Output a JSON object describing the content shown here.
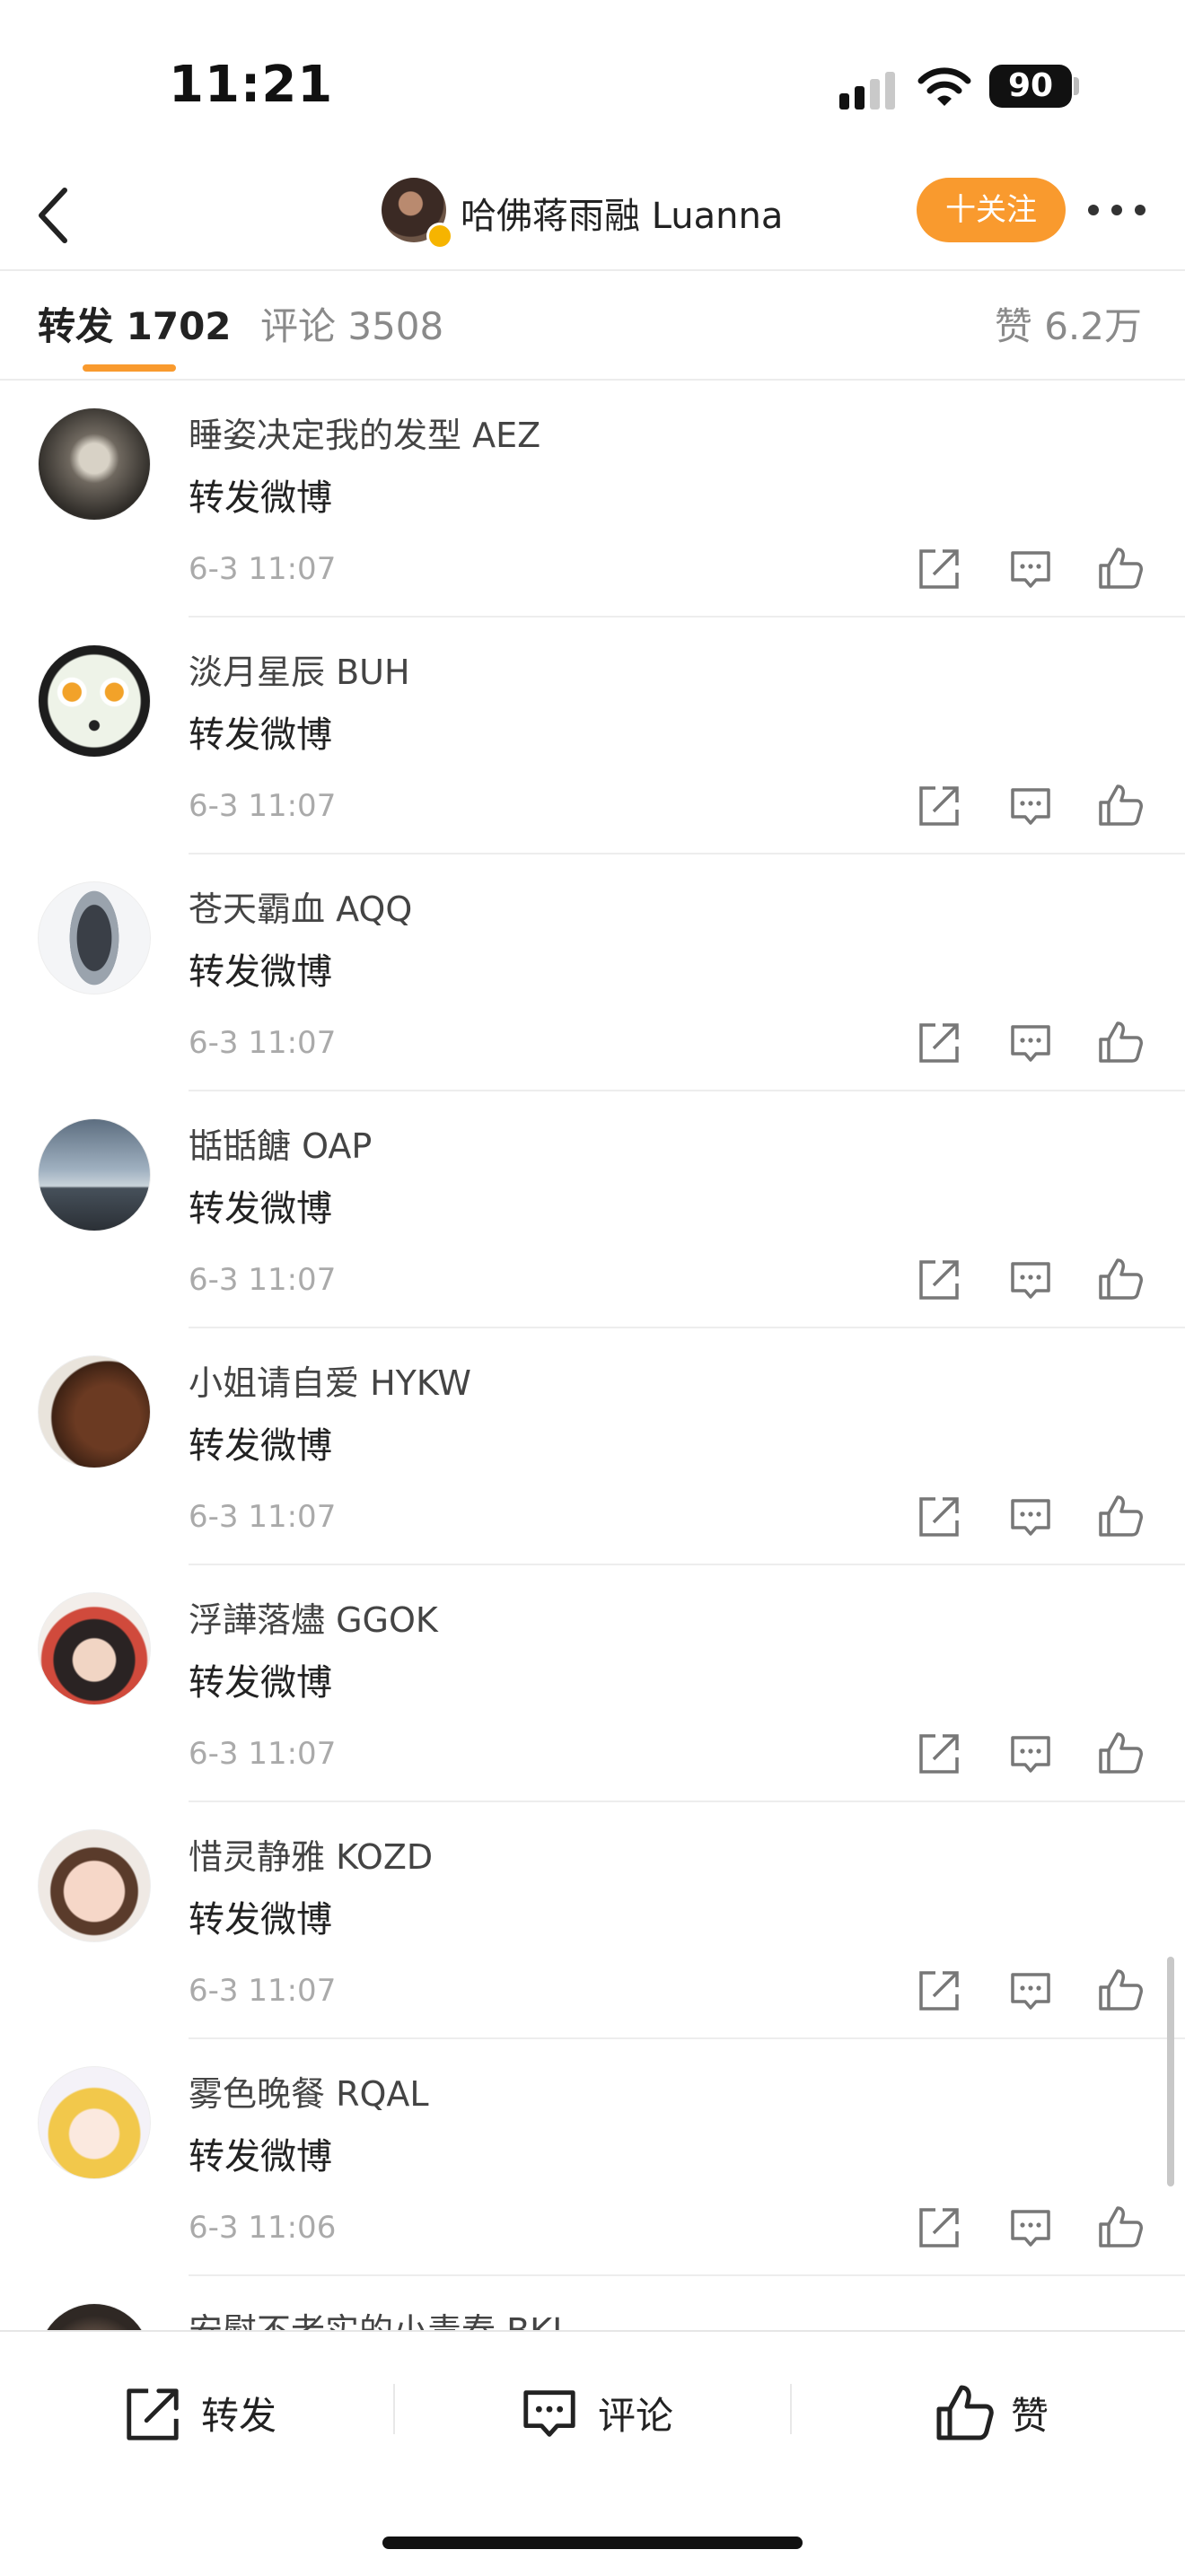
{
  "status_bar": {
    "time": "11:21",
    "battery": "90"
  },
  "header": {
    "title": "哈佛蒋雨融 Luanna",
    "follow_label": "十关注"
  },
  "tabs": {
    "repost": "转发 1702",
    "comment": "评论 3508",
    "like": "赞 6.2万"
  },
  "items": [
    {
      "name": "睡姿决定我的发型 AEZ",
      "content": "转发微博",
      "time": "6-3 11:07"
    },
    {
      "name": "淡月星辰 BUH",
      "content": "转发微博",
      "time": "6-3 11:07"
    },
    {
      "name": "苍天霸血 AQQ",
      "content": "转发微博",
      "time": "6-3 11:07"
    },
    {
      "name": "甛甛餹 OAP",
      "content": "转发微博",
      "time": "6-3 11:07"
    },
    {
      "name": "小姐请自爱 HYKW",
      "content": "转发微博",
      "time": "6-3 11:07"
    },
    {
      "name": "浮譁落燼 GGOK",
      "content": "转发微博",
      "time": "6-3 11:07"
    },
    {
      "name": "惜灵静雅 KOZD",
      "content": "转发微博",
      "time": "6-3 11:07"
    },
    {
      "name": "雾色晚餐 RQAL",
      "content": "转发微博",
      "time": "6-3 11:06"
    },
    {
      "name": "安慰不老实的小毒春 BKJ",
      "content": "",
      "time": ""
    }
  ],
  "bottom_bar": {
    "repost_label": "转发",
    "comment_label": "评论",
    "like_label": "赞"
  },
  "colors": {
    "accent": "#f99a2e",
    "text_primary": "#222222",
    "text_secondary": "#8a8a8a",
    "timestamp": "#aaaaaa"
  },
  "icons": [
    "back-arrow-icon",
    "more-icon",
    "share-icon",
    "comment-icon",
    "thumbs-up-icon"
  ]
}
